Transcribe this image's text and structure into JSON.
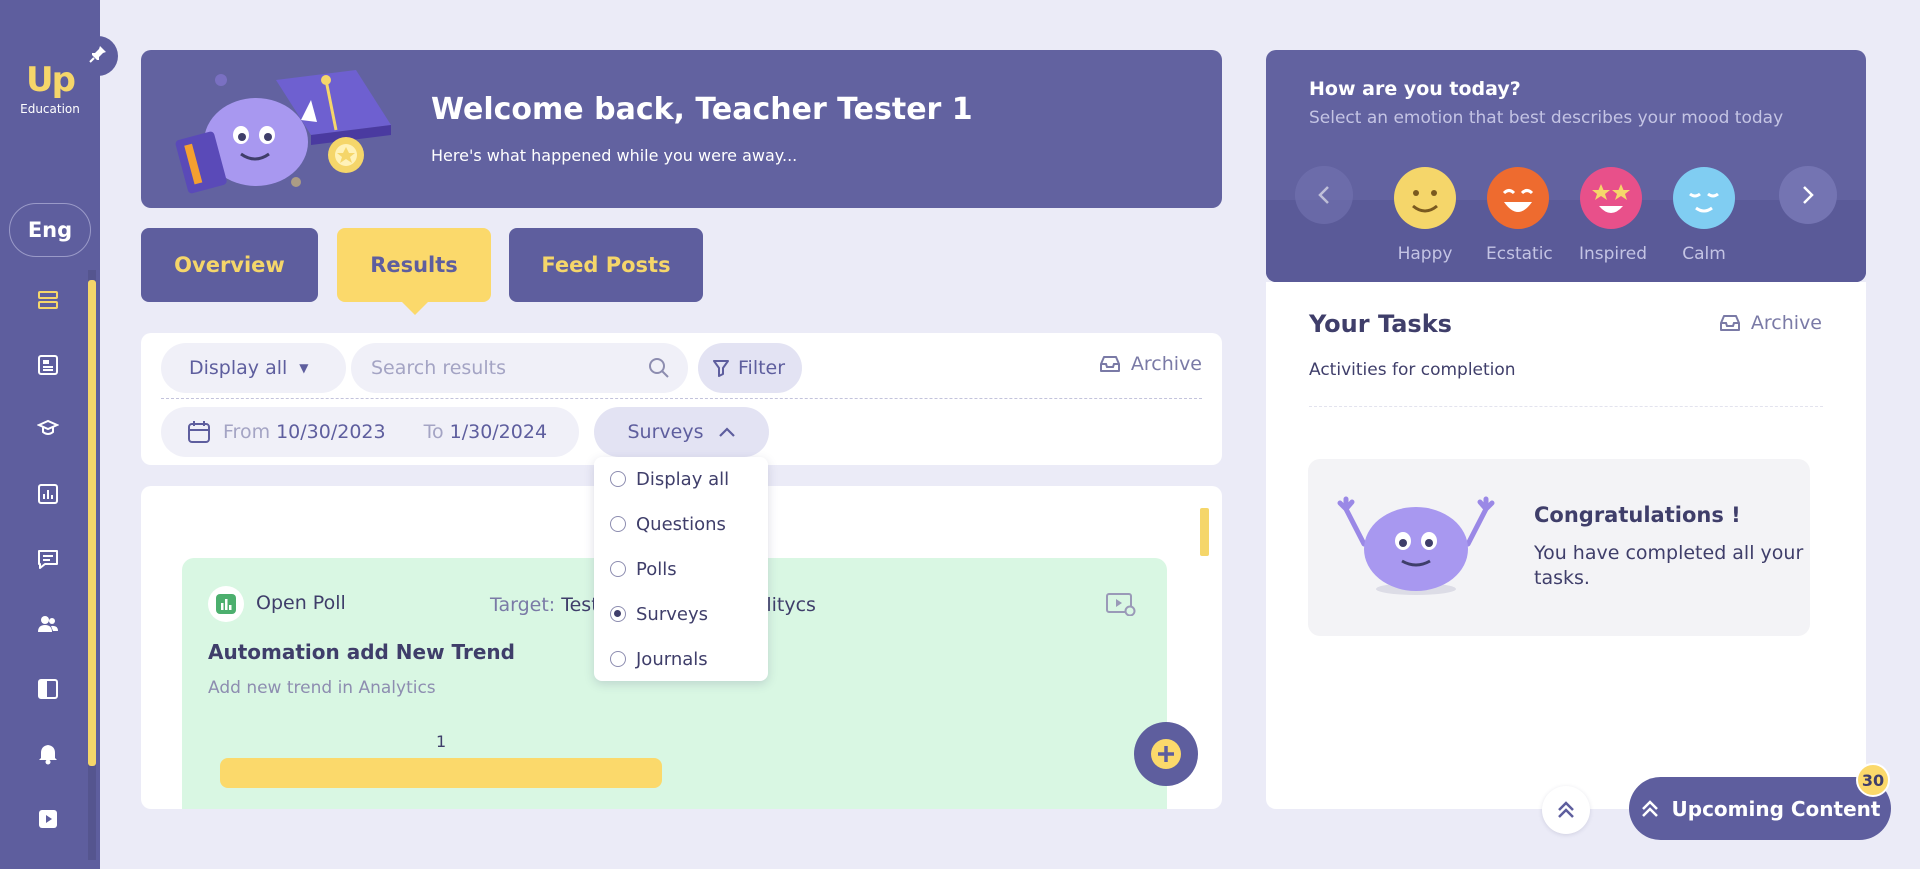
{
  "sidebar": {
    "logo_mark": "Up",
    "logo_text": "Education",
    "language": "Eng",
    "nav_icons": [
      "home-icon",
      "feed-icon",
      "courses-icon",
      "analytics-icon",
      "messages-icon",
      "groups-icon",
      "pages-icon",
      "notifications-icon",
      "video-icon"
    ]
  },
  "banner": {
    "title": "Welcome back, Teacher Tester 1",
    "subtitle": "Here's what happened while you were away..."
  },
  "tabs": [
    {
      "label": "Overview",
      "active": false
    },
    {
      "label": "Results",
      "active": true
    },
    {
      "label": "Feed Posts",
      "active": false
    }
  ],
  "filters": {
    "display_select": "Display all",
    "search_placeholder": "Search results",
    "filter_label": "Filter",
    "archive_label": "Archive",
    "from_label": "From",
    "from_value": "10/30/2023",
    "to_label": "To",
    "to_value": "1/30/2024",
    "type_select": "Surveys"
  },
  "type_dropdown": {
    "options": [
      "Display all",
      "Questions",
      "Polls",
      "Surveys",
      "Journals"
    ],
    "selected": "Surveys"
  },
  "result_card": {
    "type": "Open Poll",
    "target_label": "Target:",
    "target_value_start": "Test",
    "target_value_end": "alitycs",
    "title": "Automation add New Trend",
    "description": "Add new trend in Analytics",
    "count": "1"
  },
  "mood": {
    "title": "How are you today?",
    "subtitle": "Select an emotion that best describes your mood today",
    "emotions": [
      {
        "label": "Happy",
        "color": "#f5d66a"
      },
      {
        "label": "Ecstatic",
        "color": "#ee6b2f"
      },
      {
        "label": "Inspired",
        "color": "#e8508a"
      },
      {
        "label": "Calm",
        "color": "#80cdf2"
      }
    ]
  },
  "tasks": {
    "title": "Your Tasks",
    "archive_label": "Archive",
    "subtitle": "Activities for completion",
    "congrats_title": "Congratulations !",
    "congrats_text": "You have completed all your tasks."
  },
  "upcoming": {
    "label": "Upcoming Content",
    "badge": "30"
  },
  "colors": {
    "primary": "#5e5e9e",
    "accent": "#fbd96b",
    "background": "#ebebf7",
    "card_green": "#d9f7e3"
  }
}
